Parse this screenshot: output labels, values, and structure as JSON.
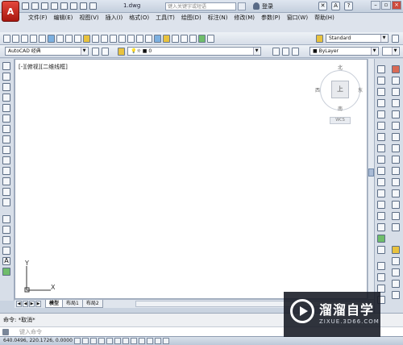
{
  "titlebar": {
    "doc_title": "1.dwg",
    "search_placeholder": "键入关键字或短语",
    "signin_label": "登录",
    "help_label": "?"
  },
  "menu": {
    "items": [
      "文件(F)",
      "编辑(E)",
      "视图(V)",
      "插入(I)",
      "格式(O)",
      "工具(T)",
      "绘图(D)",
      "标注(N)",
      "修改(M)",
      "参数(P)",
      "窗口(W)",
      "帮助(H)"
    ]
  },
  "toolbar": {
    "workspace_value": "AutoCAD 经典",
    "text_style_value": "Standard",
    "layer_value": "0",
    "color_value": "ByLayer"
  },
  "canvas": {
    "viewport_label": "[-][俯视][二维线框]",
    "viewcube": {
      "top_label": "上",
      "north": "北",
      "south": "南",
      "east": "东",
      "west": "西",
      "wcs_label": "WCS"
    },
    "ucs_y": "Y",
    "ucs_x": "X"
  },
  "tabs": {
    "items": [
      "模型",
      "布局1",
      "布局2"
    ],
    "active_index": 0
  },
  "command": {
    "history_line": "命令: *取消*",
    "prompt_placeholder": "键入命令"
  },
  "statusbar": {
    "coords": "640.0496, 220.1726, 0.0000"
  },
  "watermark": {
    "brand_text": "溜溜自学",
    "url_text": "ZIXUE.3D66.COM"
  },
  "colors": {
    "accent": "#c4cfdd",
    "canvas_bg": "#ffffff",
    "app_logo": "#c9261b"
  }
}
